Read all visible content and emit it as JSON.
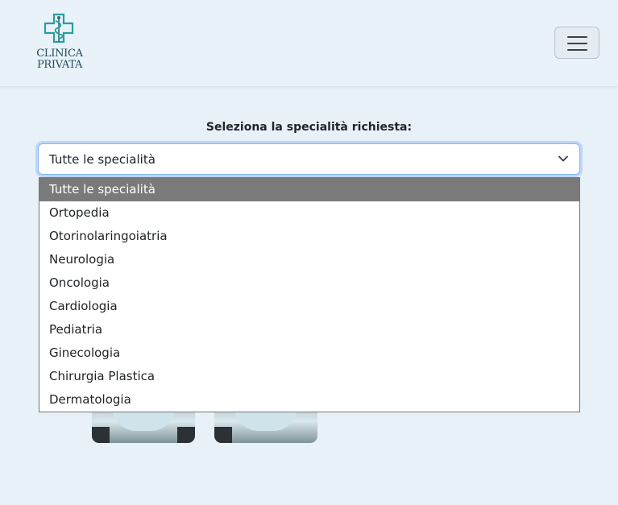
{
  "header": {
    "logo_line1": "CLINICA",
    "logo_line2": "PRIVATA",
    "logo_icon": "medical-cross-caduceus-icon",
    "menu_icon": "hamburger-menu-icon"
  },
  "colors": {
    "background": "#e8f1f8",
    "logo_teal": "#2a9d9f",
    "selected_option_bg": "#7a7a7a",
    "focus_border": "#86b7fe"
  },
  "specialty_filter": {
    "label": "Seleziona la specialità richiesta:",
    "selected_value": "Tutte le specialità",
    "options": [
      "Tutte le specialità",
      "Ortopedia",
      "Otorinolaringoiatria",
      "Neurologia",
      "Oncologia",
      "Cardiologia",
      "Pediatria",
      "Ginecologia",
      "Chirurgia Plastica",
      "Dermatologia"
    ],
    "highlighted_index": 0
  }
}
